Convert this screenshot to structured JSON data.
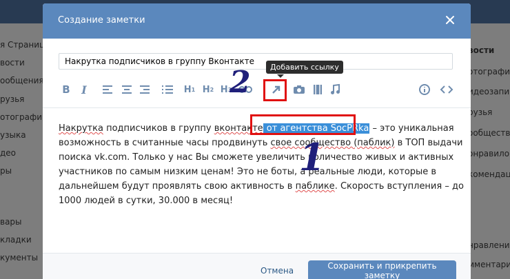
{
  "background": {
    "left_items": [
      "я Страниц",
      "вости",
      "ообщения",
      "рузья",
      "отографии",
      "узыка",
      "део",
      "ры",
      "вары",
      "кладки",
      "кументы"
    ],
    "right_items": [
      "вости",
      "отографи",
      "идеозапи",
      "рузья",
      "ообществ",
      "онравило",
      "комендац",
      "нравления",
      "мментари"
    ]
  },
  "modal": {
    "title": "Создание заметки",
    "close_icon": "close-icon",
    "title_input_value": "Накрутка подписчиков в группу Вконтакте",
    "tooltip": "Добавить ссылку",
    "toolbar": {
      "bold": "B",
      "italic": "I",
      "h1": "H1",
      "h2": "H2",
      "h3": "H3",
      "sub1": "1",
      "sub2": "2",
      "sub3": "3"
    },
    "editor": {
      "l1_a": "Накрутка",
      "l1_b": " подписчиков в группу ",
      "l1_c": "вконтакте",
      "l1_hl": " от агентства SocPRka",
      "l1_d": " – это уникальная",
      "l2_a": "возможность в считанные часы продвинуть ",
      "l2_b": "свое сообщество (паблик)",
      "l2_c": " в ТОП выдачи",
      "l3": "поиска vk.com. Только у нас Вы сможете увеличить количество живых и активных",
      "l4": "участников по самым низким ценам! Это не боты, а реальные люди, которые в",
      "l5_a": "дальнейшем будут проявлять свою активность в ",
      "l5_b": "паблике",
      "l5_c": ". Скорость вступления – до",
      "l6": "1000 людей в сутки, 30.000 в месяц!"
    },
    "cancel_label": "Отмена",
    "save_label": "Сохранить и прикрепить заметку"
  },
  "annotations": {
    "num1": "1",
    "num2": "2"
  },
  "colors": {
    "accent": "#5b88bd",
    "highlight": "#3a8fd9",
    "annotation_red": "#e01010"
  }
}
